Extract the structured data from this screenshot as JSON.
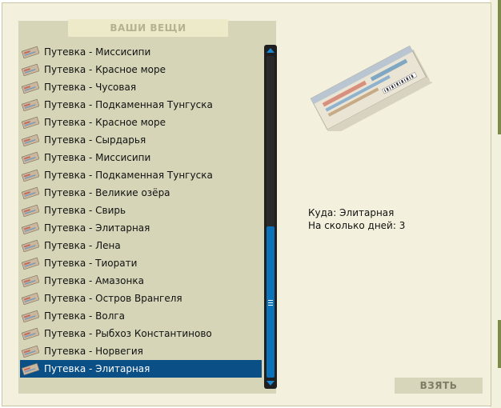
{
  "panel": {
    "title": "ВАШИ ВЕЩИ"
  },
  "items": [
    {
      "label": "Путевка - Миссисипи"
    },
    {
      "label": "Путевка - Красное море"
    },
    {
      "label": "Путевка - Чусовая"
    },
    {
      "label": "Путевка - Подкаменная Тунгуска"
    },
    {
      "label": "Путевка - Красное море"
    },
    {
      "label": "Путевка - Сырдарья"
    },
    {
      "label": "Путевка - Миссисипи"
    },
    {
      "label": "Путевка - Подкаменная Тунгуска"
    },
    {
      "label": "Путевка - Великие озёра"
    },
    {
      "label": "Путевка - Свирь"
    },
    {
      "label": "Путевка - Элитарная"
    },
    {
      "label": "Путевка - Лена"
    },
    {
      "label": "Путевка - Тиорати"
    },
    {
      "label": "Путевка - Амазонка"
    },
    {
      "label": "Путевка - Остров Врангеля"
    },
    {
      "label": "Путевка - Волга"
    },
    {
      "label": "Путевка - Рыбхоз Константиново"
    },
    {
      "label": "Путевка - Норвегия"
    },
    {
      "label": "Путевка - Элитарная"
    }
  ],
  "selected_index": 18,
  "item_icon": "ticket-icon",
  "scroll": {
    "thumb_start": 0.53,
    "thumb_end": 1.0
  },
  "details": {
    "destination_label": "Куда:",
    "destination_value": "Элитарная",
    "days_label": "На сколько дней:",
    "days_value": "3"
  },
  "take_button": {
    "label": "ВЗЯТЬ"
  },
  "colors": {
    "selection": "#0a4f86",
    "scroll_thumb": "#0b71b8",
    "panel_bg": "#d6d5b8",
    "dialog_bg": "#f3f1dd"
  }
}
